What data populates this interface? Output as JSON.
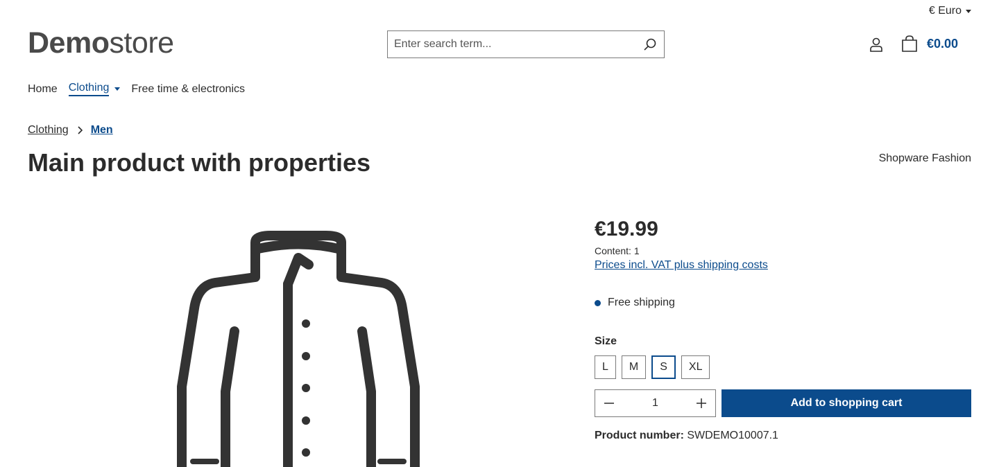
{
  "header": {
    "currency": "€ Euro",
    "logo_bold": "Demo",
    "logo_light": "store",
    "search_placeholder": "Enter search term...",
    "cart_total": "€0.00"
  },
  "nav": {
    "items": [
      {
        "label": "Home"
      },
      {
        "label": "Clothing"
      },
      {
        "label": "Free time & electronics"
      }
    ]
  },
  "breadcrumb": {
    "items": [
      {
        "label": "Clothing"
      },
      {
        "label": "Men"
      }
    ]
  },
  "product": {
    "title": "Main product with properties",
    "manufacturer": "Shopware Fashion",
    "price": "€19.99",
    "content": "Content: 1",
    "vat_link": "Prices incl. VAT plus shipping costs",
    "shipping": "Free shipping",
    "size_label": "Size",
    "sizes": [
      "L",
      "M",
      "S",
      "XL"
    ],
    "selected_size": "S",
    "quantity": "1",
    "add_to_cart": "Add to shopping cart",
    "number_label": "Product number:",
    "number": "SWDEMO10007.1"
  },
  "colors": {
    "accent": "#0b4b8c",
    "text": "#2b2b2b"
  }
}
